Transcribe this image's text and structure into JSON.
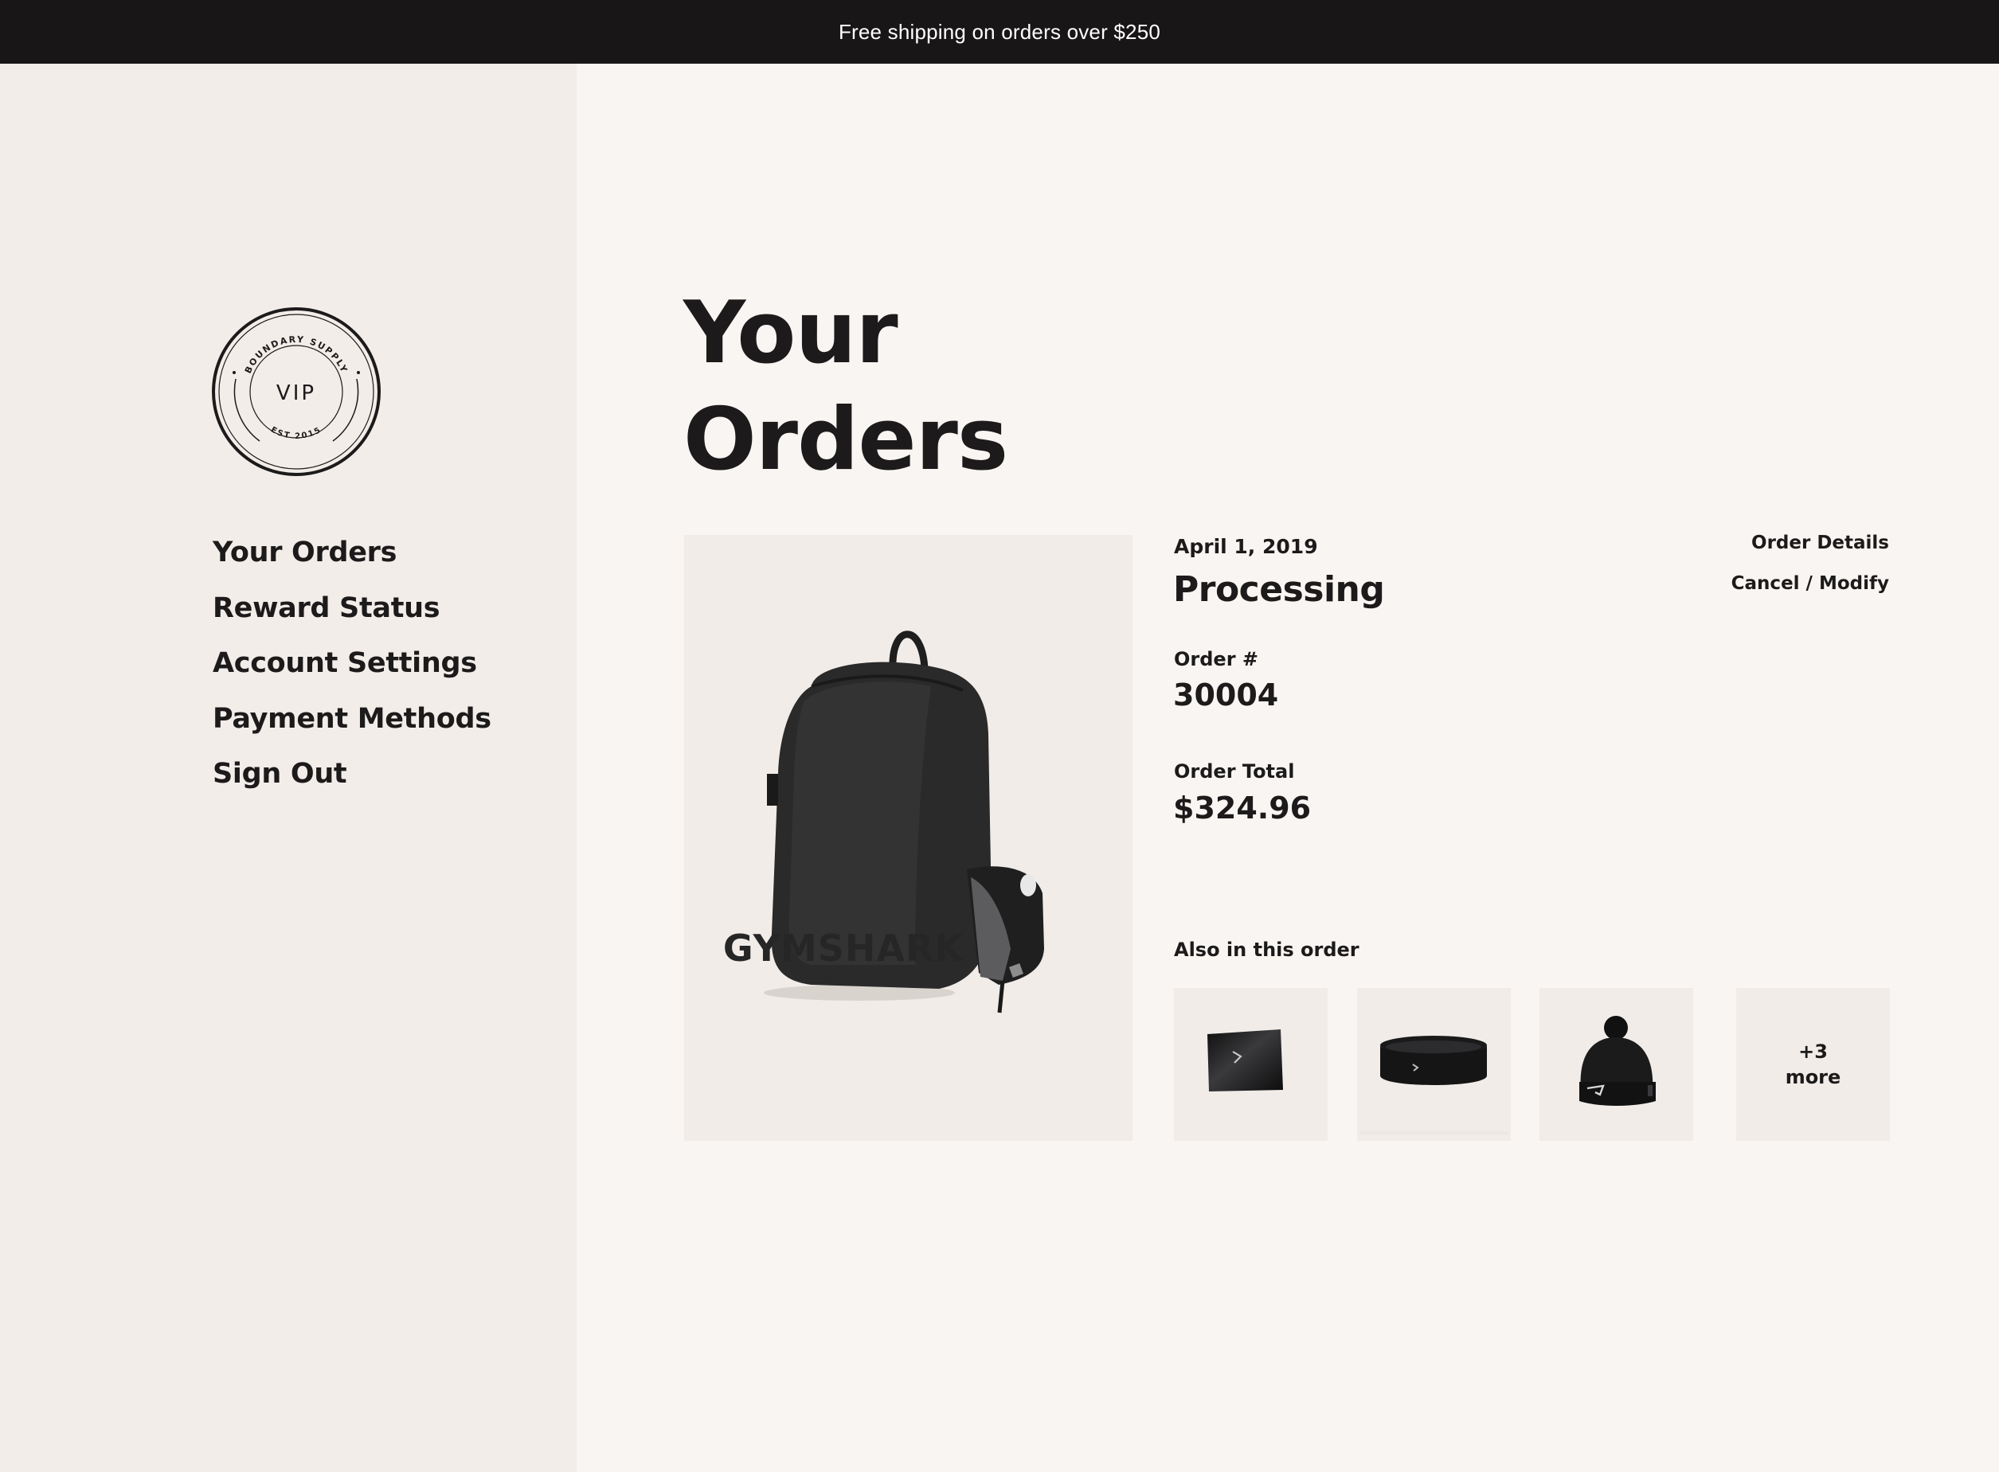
{
  "promo_bar": {
    "text": "Free shipping on orders over $250"
  },
  "logo": {
    "center_text": "VIP",
    "top_arc_text": "BOUNDARY SUPPLY",
    "bottom_arc_text": "EST 2015"
  },
  "sidebar": {
    "items": [
      {
        "label": "Your Orders",
        "active": true
      },
      {
        "label": "Reward Status",
        "active": false
      },
      {
        "label": "Account Settings",
        "active": false
      },
      {
        "label": "Payment Methods",
        "active": false
      },
      {
        "label": "Sign Out",
        "active": false
      }
    ]
  },
  "main": {
    "title_line1": "Your",
    "title_line2": "Orders"
  },
  "order": {
    "date": "April 1, 2019",
    "status": "Processing",
    "details_link": "Order Details",
    "cancel_link": "Cancel / Modify",
    "number_label": "Order #",
    "number_value": "30004",
    "total_label": "Order Total",
    "total_value": "$324.96",
    "hero_product": "backpack",
    "hero_brand_text": "GYMSHARK",
    "also_label": "Also in this order",
    "also_items": [
      "gift-card",
      "headband",
      "beanie"
    ],
    "more_line1": "+3",
    "more_line2": "more"
  },
  "colors": {
    "topbar": "#181617",
    "sidebar": "#f2ede9",
    "page": "#f8f5f2",
    "tile": "#f1ece8",
    "accent_underline": "#e7ddd5",
    "text": "#1c1a1a"
  }
}
